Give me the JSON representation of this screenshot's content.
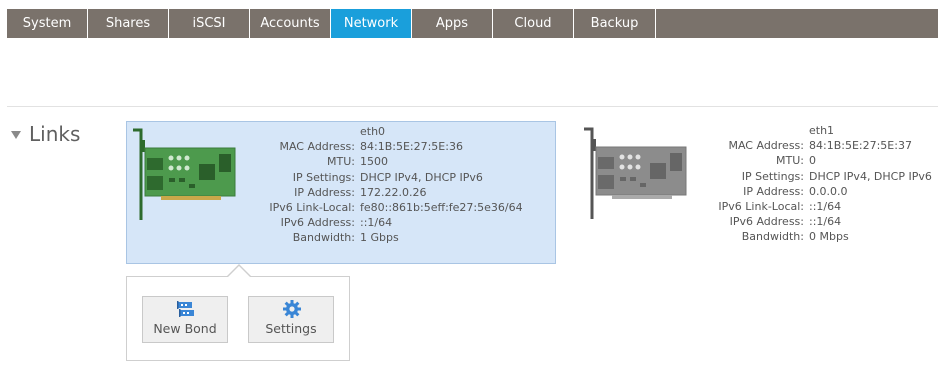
{
  "nav": {
    "tabs": [
      {
        "label": "System"
      },
      {
        "label": "Shares"
      },
      {
        "label": "iSCSI"
      },
      {
        "label": "Accounts"
      },
      {
        "label": "Network"
      },
      {
        "label": "Apps"
      },
      {
        "label": "Cloud"
      },
      {
        "label": "Backup"
      }
    ],
    "active": "Network",
    "active_color": "#1a9fdb",
    "bar_color": "#7a726b"
  },
  "section": {
    "title": "Links"
  },
  "adapters": [
    {
      "name": "eth0",
      "selected": true,
      "fields": [
        {
          "label": "MAC Address:",
          "value": "84:1B:5E:27:5E:36"
        },
        {
          "label": "MTU:",
          "value": "1500"
        },
        {
          "label": "IP Settings:",
          "value": "DHCP IPv4, DHCP IPv6"
        },
        {
          "label": "IP Address:",
          "value": "172.22.0.26"
        },
        {
          "label": "IPv6 Link-Local:",
          "value": "fe80::861b:5eff:fe27:5e36/64"
        },
        {
          "label": "IPv6 Address:",
          "value": "::1/64"
        },
        {
          "label": "Bandwidth:",
          "value": "1 Gbps"
        }
      ]
    },
    {
      "name": "eth1",
      "selected": false,
      "fields": [
        {
          "label": "MAC Address:",
          "value": "84:1B:5E:27:5E:37"
        },
        {
          "label": "MTU:",
          "value": "0"
        },
        {
          "label": "IP Settings:",
          "value": "DHCP IPv4, DHCP IPv6"
        },
        {
          "label": "IP Address:",
          "value": "0.0.0.0"
        },
        {
          "label": "IPv6 Link-Local:",
          "value": "::1/64"
        },
        {
          "label": "IPv6 Address:",
          "value": "::1/64"
        },
        {
          "label": "Bandwidth:",
          "value": "0 Mbps"
        }
      ]
    }
  ],
  "popover": {
    "buttons": [
      {
        "label": "New Bond",
        "icon": "bond-icon"
      },
      {
        "label": "Settings",
        "icon": "gear-icon"
      }
    ]
  }
}
